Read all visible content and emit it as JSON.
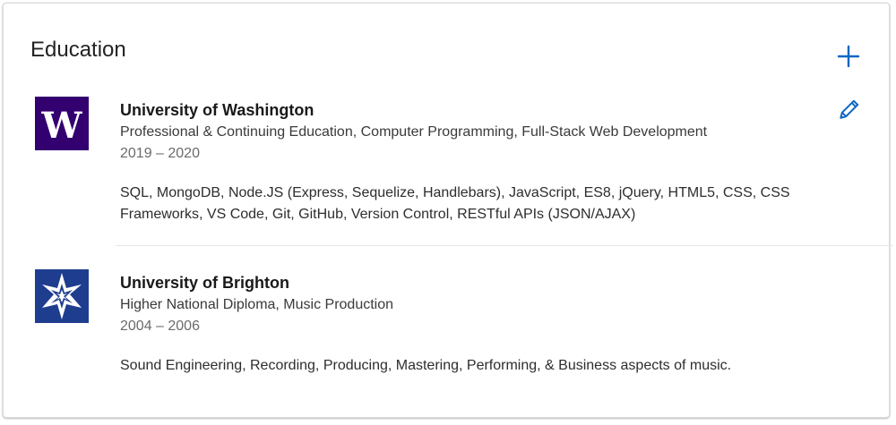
{
  "section": {
    "title": "Education"
  },
  "actions": {
    "add_icon": "plus-icon",
    "edit_icon": "pencil-icon",
    "accent_color": "#0a66c2"
  },
  "entries": [
    {
      "school": "University of Washington",
      "degree": "Professional & Continuing Education, Computer Programming, Full-Stack Web Development",
      "dates": "2019 – 2020",
      "description": "SQL, MongoDB, Node.JS (Express, Sequelize, Handlebars), JavaScript, ES8, jQuery, HTML5, CSS, CSS Frameworks, VS Code, Git, GitHub, Version Control, RESTful APIs (JSON/AJAX)",
      "logo": {
        "letter": "W",
        "bg": "#33006f",
        "fg": "#ffffff"
      }
    },
    {
      "school": "University of Brighton",
      "degree": "Higher National Diploma, Music Production",
      "dates": "2004 – 2006",
      "description": "Sound Engineering, Recording, Producing, Mastering, Performing, & Business aspects of music.",
      "logo": {
        "bg": "#1f3d8f",
        "fg": "#ffffff"
      }
    }
  ]
}
